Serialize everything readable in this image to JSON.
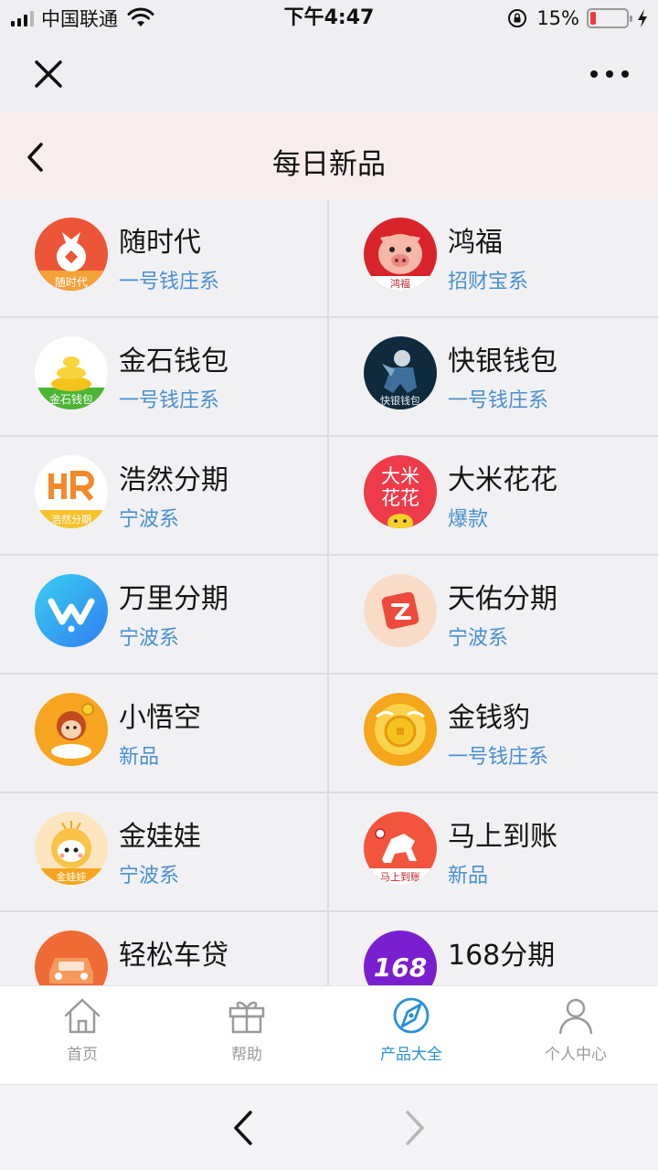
{
  "status_bar": {
    "carrier": "中国联通",
    "time": "下午4:47",
    "battery_percent": "15%",
    "battery_level": 0.15
  },
  "page": {
    "title": "每日新品"
  },
  "products": [
    {
      "name": "随时代",
      "tag": "一号钱庄系",
      "logo_text": "随时代"
    },
    {
      "name": "鸿福",
      "tag": "招财宝系",
      "logo_text": "鸿福"
    },
    {
      "name": "金石钱包",
      "tag": "一号钱庄系",
      "logo_text": "金石钱包"
    },
    {
      "name": "快银钱包",
      "tag": "一号钱庄系",
      "logo_text": "快银钱包"
    },
    {
      "name": "浩然分期",
      "tag": "宁波系",
      "logo_text": "浩然分期"
    },
    {
      "name": "大米花花",
      "tag": "爆款",
      "logo_text": "大米花花"
    },
    {
      "name": "万里分期",
      "tag": "宁波系"
    },
    {
      "name": "天佑分期",
      "tag": "宁波系"
    },
    {
      "name": "小悟空",
      "tag": "新品"
    },
    {
      "name": "金钱豹",
      "tag": "一号钱庄系"
    },
    {
      "name": "金娃娃",
      "tag": "宁波系",
      "logo_text": "金娃娃"
    },
    {
      "name": "马上到账",
      "tag": "新品",
      "logo_text": "马上到账"
    },
    {
      "name": "轻松车贷",
      "tag": ""
    },
    {
      "name": "168分期",
      "tag": "",
      "logo_text": "168"
    }
  ],
  "tab_bar": {
    "tabs": [
      {
        "label": "首页",
        "icon": "home-icon",
        "active": false
      },
      {
        "label": "帮助",
        "icon": "gift-icon",
        "active": false
      },
      {
        "label": "产品大全",
        "icon": "compass-icon",
        "active": true
      },
      {
        "label": "个人中心",
        "icon": "user-icon",
        "active": false
      }
    ]
  },
  "colors": {
    "accent": "#2b8fd6",
    "tag_text": "#4a8fd0",
    "header_bg": "#f8eded",
    "battery_low": "#ee3b3b"
  }
}
